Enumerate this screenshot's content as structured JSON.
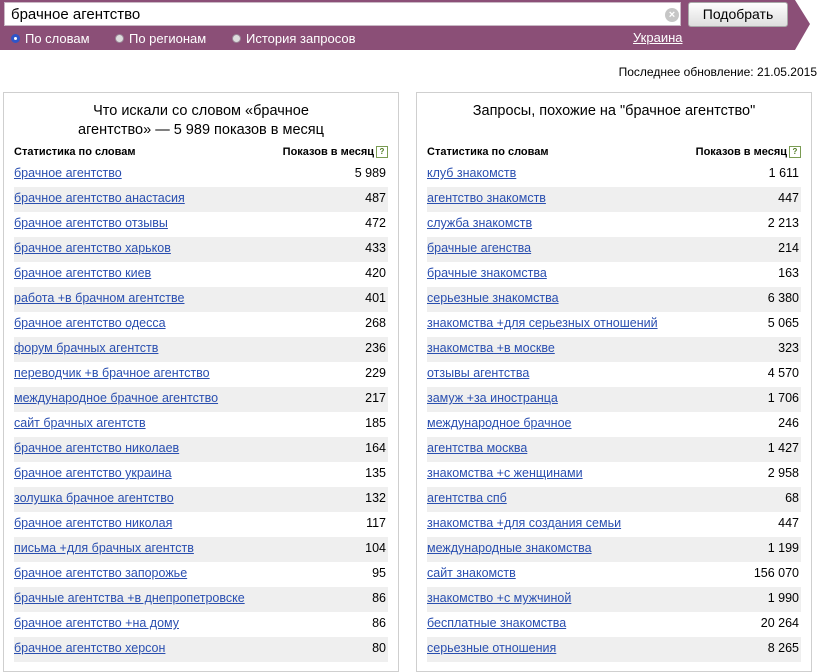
{
  "search": {
    "query": "брачное агентство",
    "clear_icon": "×",
    "submit_label": "Подобрать"
  },
  "modes": [
    {
      "label": "По словам",
      "selected": true
    },
    {
      "label": "По регионам",
      "selected": false
    },
    {
      "label": "История запросов",
      "selected": false
    }
  ],
  "region": "Украина",
  "updated": "Последнее обновление: 21.05.2015",
  "colors": {
    "bar": "#8b4f77",
    "link": "#2a4fb0",
    "radio_selected": "#2f55c8"
  },
  "left_panel": {
    "title": "Что искали со словом «брачное агентство» — 5 989 показов в месяц",
    "col_phrase": "Статистика по словам",
    "col_count": "Показов в месяц",
    "rows": [
      {
        "phrase": "брачное агентство",
        "count": "5 989"
      },
      {
        "phrase": "брачное агентство анастасия",
        "count": "487"
      },
      {
        "phrase": "брачное агентство отзывы",
        "count": "472"
      },
      {
        "phrase": "брачное агентство харьков",
        "count": "433"
      },
      {
        "phrase": "брачное агентство киев",
        "count": "420"
      },
      {
        "phrase": "работа +в брачном агентстве",
        "count": "401"
      },
      {
        "phrase": "брачное агентство одесса",
        "count": "268"
      },
      {
        "phrase": "форум брачных агентств",
        "count": "236"
      },
      {
        "phrase": "переводчик +в брачное агентство",
        "count": "229"
      },
      {
        "phrase": "международное брачное агентство",
        "count": "217"
      },
      {
        "phrase": "сайт брачных агентств",
        "count": "185"
      },
      {
        "phrase": "брачное агентство николаев",
        "count": "164"
      },
      {
        "phrase": "брачное агентство украина",
        "count": "135"
      },
      {
        "phrase": "золушка брачное агентство",
        "count": "132"
      },
      {
        "phrase": "брачное агентство николая",
        "count": "117"
      },
      {
        "phrase": "письма +для брачных агентств",
        "count": "104"
      },
      {
        "phrase": "брачное агентство запорожье",
        "count": "95"
      },
      {
        "phrase": "брачные агентства +в днепропетровске",
        "count": "86"
      },
      {
        "phrase": "брачное агентство +на дому",
        "count": "86"
      },
      {
        "phrase": "брачное агентство херсон",
        "count": "80"
      }
    ]
  },
  "right_panel": {
    "title": "Запросы, похожие на \"брачное агентство\"",
    "col_phrase": "Статистика по словам",
    "col_count": "Показов в месяц",
    "rows": [
      {
        "phrase": "клуб знакомств",
        "count": "1 611"
      },
      {
        "phrase": "агентство знакомств",
        "count": "447"
      },
      {
        "phrase": "служба знакомств",
        "count": "2 213"
      },
      {
        "phrase": "брачные агенства",
        "count": "214"
      },
      {
        "phrase": "брачные знакомства",
        "count": "163"
      },
      {
        "phrase": "серьезные знакомства",
        "count": "6 380"
      },
      {
        "phrase": "знакомства +для серьезных отношений",
        "count": "5 065"
      },
      {
        "phrase": "знакомства +в москве",
        "count": "323"
      },
      {
        "phrase": "отзывы агентства",
        "count": "4 570"
      },
      {
        "phrase": "замуж +за иностранца",
        "count": "1 706"
      },
      {
        "phrase": "международное брачное",
        "count": "246"
      },
      {
        "phrase": "агентства москва",
        "count": "1 427"
      },
      {
        "phrase": "знакомства +с женщинами",
        "count": "2 958"
      },
      {
        "phrase": "агентства спб",
        "count": "68"
      },
      {
        "phrase": "знакомства +для создания семьи",
        "count": "447"
      },
      {
        "phrase": "международные знакомства",
        "count": "1 199"
      },
      {
        "phrase": "сайт знакомств",
        "count": "156 070"
      },
      {
        "phrase": "знакомство +с мужчиной",
        "count": "1 990"
      },
      {
        "phrase": "бесплатные знакомства",
        "count": "20 264"
      },
      {
        "phrase": "серьезные отношения",
        "count": "8 265"
      }
    ]
  }
}
